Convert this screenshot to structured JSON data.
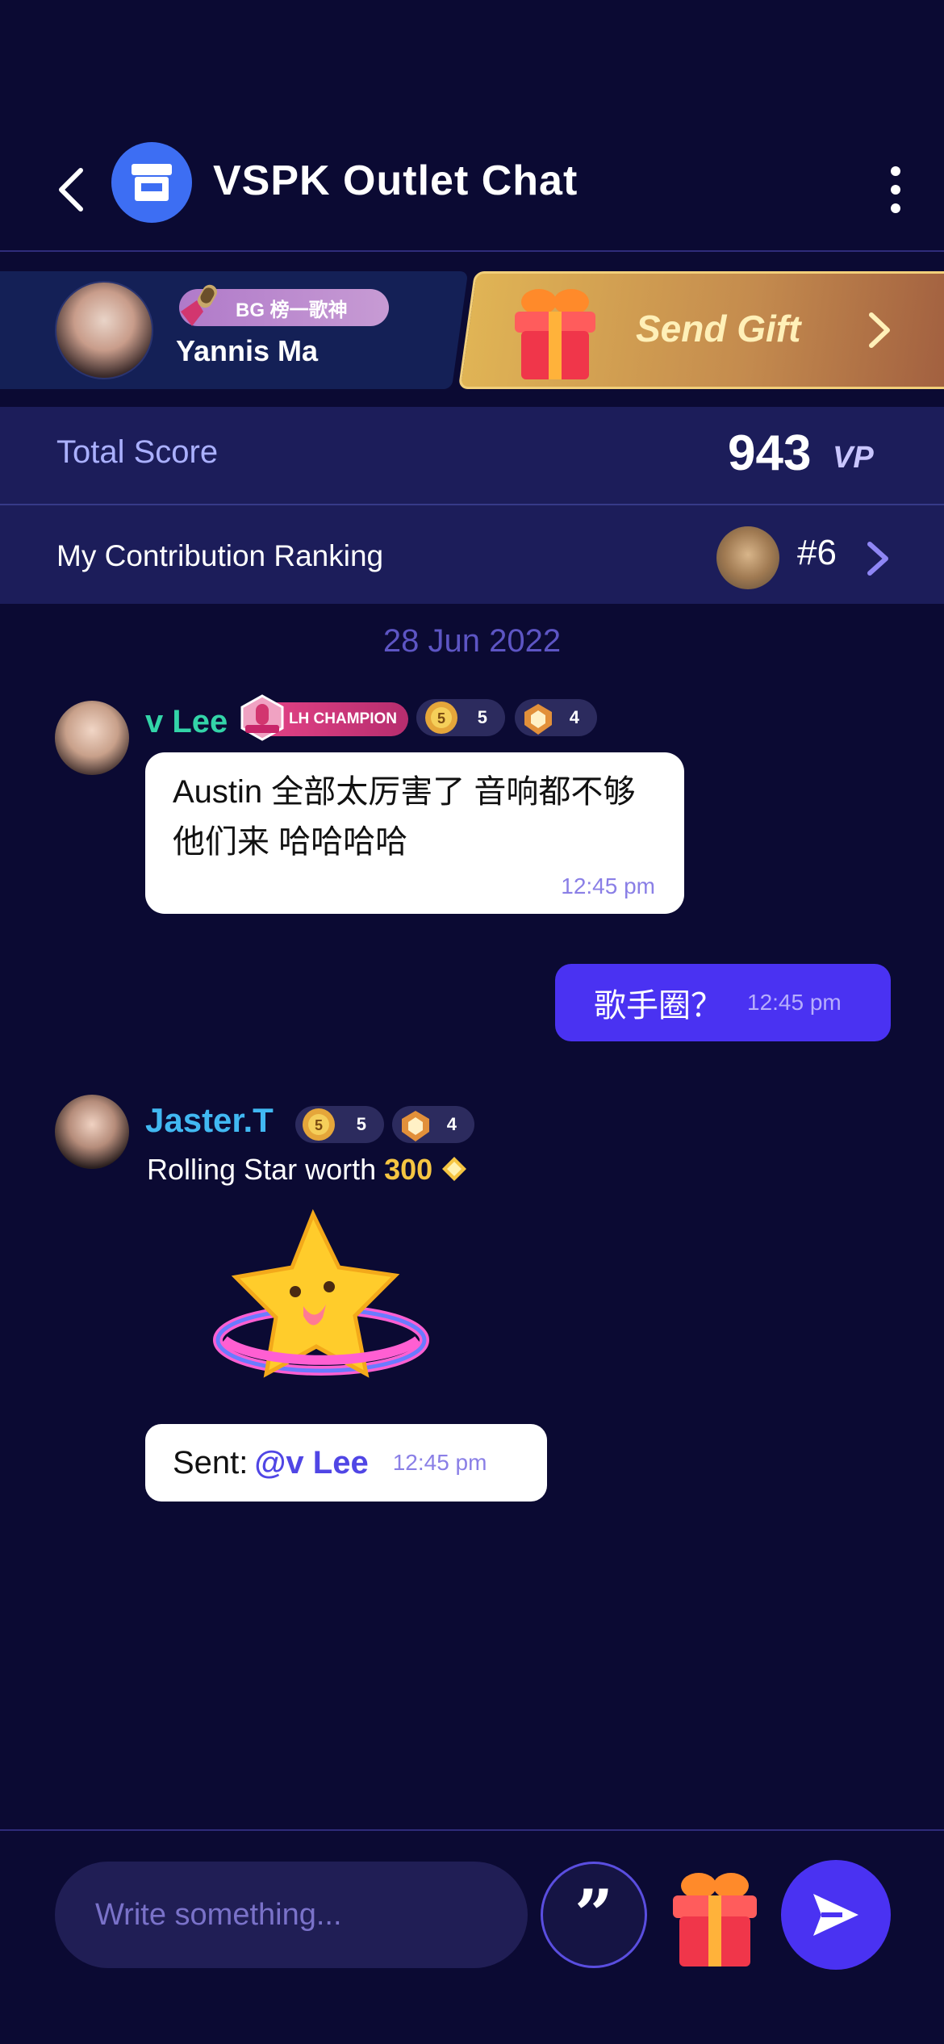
{
  "header": {
    "title": "VSPK Outlet Chat",
    "back_icon": "back-chevron-icon",
    "store_icon": "store-icon",
    "more_icon": "more-vertical-icon"
  },
  "host": {
    "name": "Yannis Ma",
    "badge": "BG 榜一歌神"
  },
  "gift_button": {
    "label": "Send Gift"
  },
  "score": {
    "label": "Total Score",
    "value": "943",
    "unit": "VP"
  },
  "ranking": {
    "label": "My Contribution Ranking",
    "value": "#6"
  },
  "date_separator": "28 Jun 2022",
  "messages": [
    {
      "sender": "v Lee",
      "badges": {
        "champion": "LH CHAMPION",
        "level": "5",
        "rank": "4"
      },
      "text": "Austin 全部太厉害了 音响都不够他们来 哈哈哈哈",
      "time": "12:45 pm"
    },
    {
      "self": true,
      "text": "歌手圈？",
      "time": "12:45 pm"
    },
    {
      "sender": "Jaster.T",
      "badges": {
        "level": "5",
        "rank": "4"
      },
      "gift_line": {
        "prefix": "Rolling Star worth",
        "amount": "300"
      },
      "sent_prefix": "Sent:",
      "mention": "@v Lee",
      "time": "12:45 pm"
    }
  ],
  "composer": {
    "placeholder": "Write something..."
  },
  "colors": {
    "background": "#0b0a33",
    "accent": "#4a32f2",
    "name_green": "#33d4a8",
    "name_blue": "#41b8f2",
    "gold": "#f5c542"
  }
}
